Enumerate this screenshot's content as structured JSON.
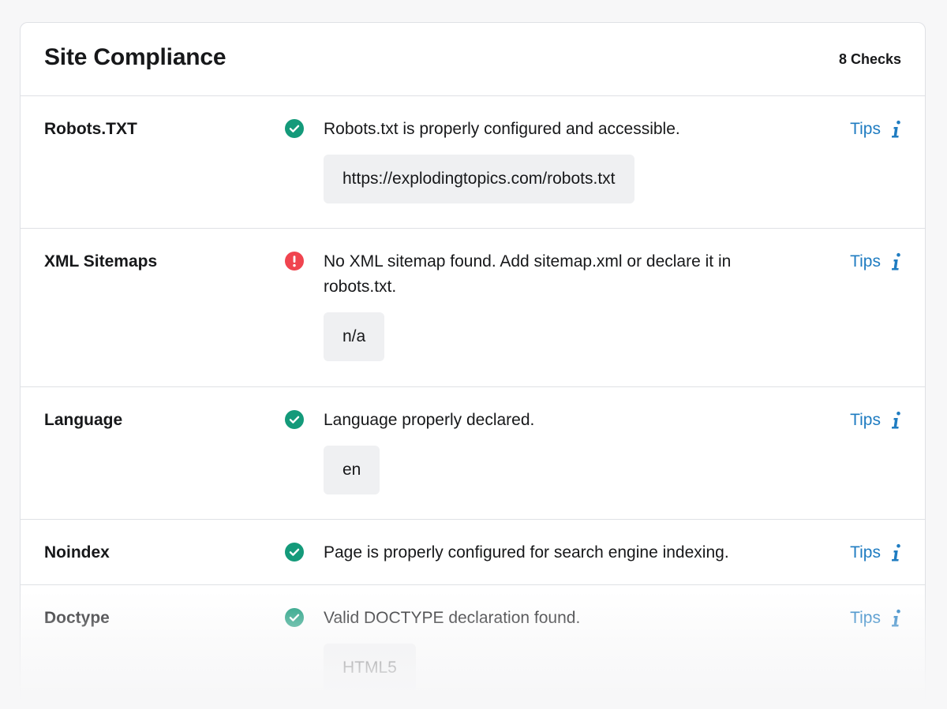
{
  "header": {
    "title": "Site Compliance",
    "count": "8 Checks"
  },
  "checks": [
    {
      "name": "Robots.TXT",
      "status": "pass",
      "status_icon": "check-circle-icon",
      "message": "Robots.txt is properly configured and accessible.",
      "value": "https://explodingtopics.com/robots.txt",
      "tips_label": "Tips"
    },
    {
      "name": "XML Sitemaps",
      "status": "error",
      "status_icon": "exclamation-circle-icon",
      "message": "No XML sitemap found. Add sitemap.xml or declare it in robots.txt.",
      "value": "n/a",
      "tips_label": "Tips"
    },
    {
      "name": "Language",
      "status": "pass",
      "status_icon": "check-circle-icon",
      "message": "Language properly declared.",
      "value": "en",
      "tips_label": "Tips"
    },
    {
      "name": "Noindex",
      "status": "pass",
      "status_icon": "check-circle-icon",
      "message": "Page is properly configured for search engine indexing.",
      "value": "",
      "tips_label": "Tips"
    },
    {
      "name": "Doctype",
      "status": "pass",
      "status_icon": "check-circle-icon",
      "message": "Valid DOCTYPE declaration found.",
      "value": "HTML5",
      "tips_label": "Tips"
    }
  ],
  "colors": {
    "pass": "#149a7a",
    "error": "#f0444f",
    "link": "#1f7cc1",
    "pill_bg": "#eff0f2",
    "border": "#dfe1e5"
  }
}
